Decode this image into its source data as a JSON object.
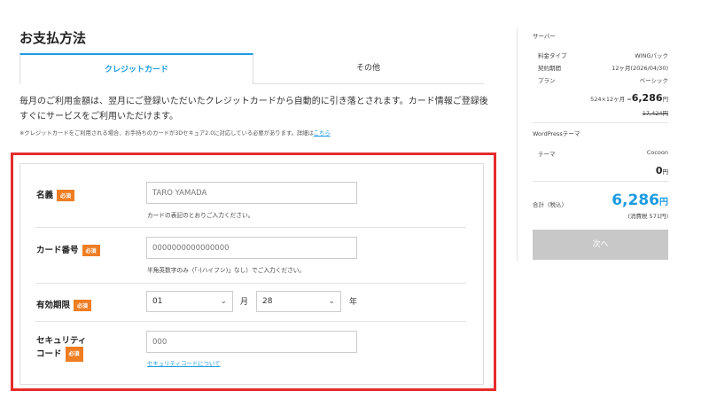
{
  "page": {
    "title": "お支払方法"
  },
  "tabs": [
    {
      "label": "クレジットカード"
    },
    {
      "label": "その他"
    }
  ],
  "description": {
    "line1": "毎月のご利用金額は、翌月にご登録いただいたクレジットカードから自動的に引き落とされます。カード情報ご登録後",
    "line2": "すぐにサービスをご利用いただけます。",
    "note": "※クレジットカードをご利用される場合、お手持ちのカードが3Dセキュア2.0に対応している必要があります。詳細は",
    "note_link": "こちら"
  },
  "form": {
    "required_badge": "必須",
    "name": {
      "label": "名義",
      "placeholder": "TARO YAMADA",
      "hint": "カードの表記のとおりご入力ください。"
    },
    "card_number": {
      "label": "カード番号",
      "placeholder": "0000000000000000",
      "hint": "半角英数字のみ（「-(ハイフン)」なし）でご入力ください。"
    },
    "expiry": {
      "label": "有効期限",
      "month_value": "01",
      "month_unit": "月",
      "year_value": "28",
      "year_unit": "年"
    },
    "security": {
      "label_line1": "セキュリティ",
      "label_line2": "コード",
      "placeholder": "000",
      "link": "セキュリティコードについて"
    }
  },
  "summary": {
    "server_heading": "サーバー",
    "rows": [
      {
        "label": "料金タイプ",
        "value": "WINGパック"
      },
      {
        "label": "契約期間",
        "value": "12ヶ月(2026/04/30)"
      },
      {
        "label": "プラン",
        "value": "ベーシック"
      }
    ],
    "price_calc": "524×12ヶ月 =",
    "price_amount": "6,286",
    "price_unit": "円",
    "old_price": "17,424円",
    "theme_heading": "WordPressテーマ",
    "theme_label": "テーマ",
    "theme_value": "Cocoon",
    "theme_price": "0",
    "theme_price_unit": "円",
    "total_label": "合計（税込）",
    "total_amount": "6,286",
    "total_unit": "円",
    "tax_note": "(消費税 571円)",
    "next_button": "次へ"
  }
}
